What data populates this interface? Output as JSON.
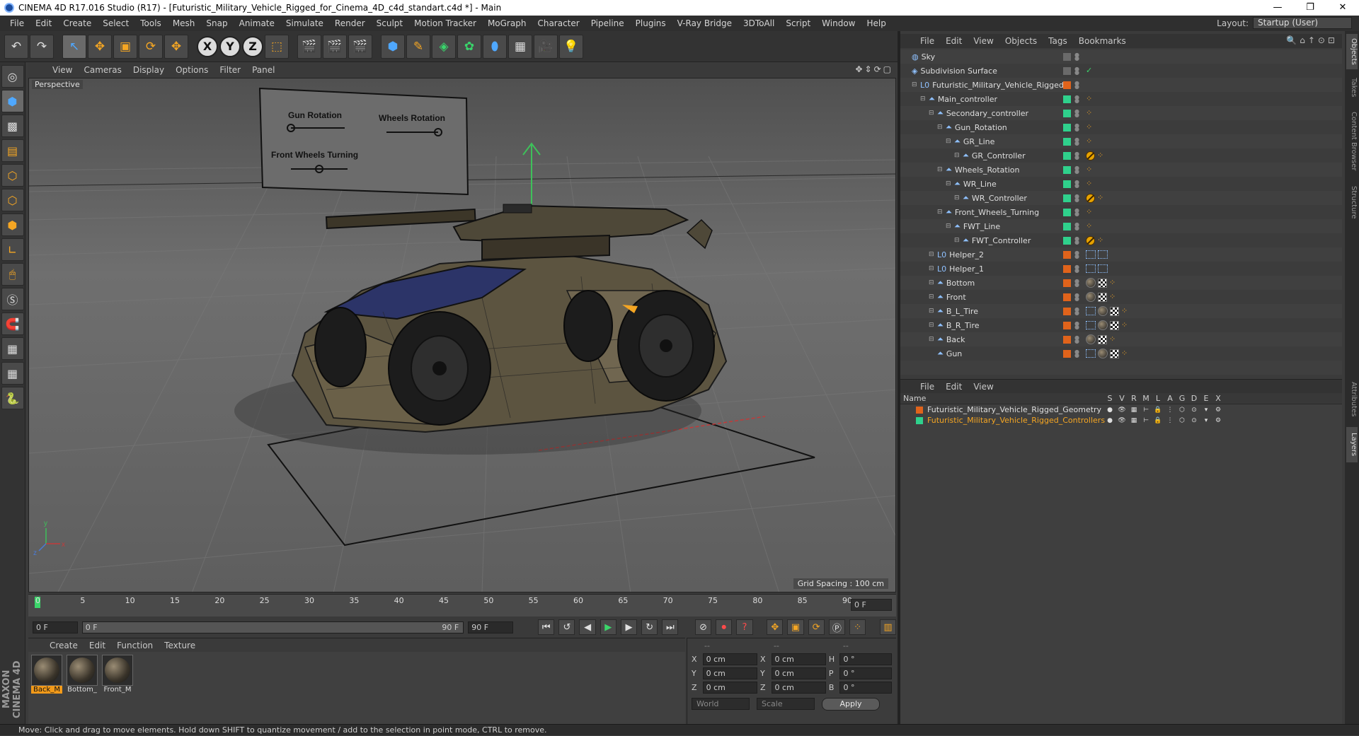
{
  "window": {
    "title": "CINEMA 4D R17.016 Studio (R17) - [Futuristic_Military_Vehicle_Rigged_for_Cinema_4D_c4d_standart.c4d *] - Main",
    "min": "—",
    "max": "❐",
    "close": "✕"
  },
  "menubar": {
    "items": [
      "File",
      "Edit",
      "Create",
      "Select",
      "Tools",
      "Mesh",
      "Snap",
      "Animate",
      "Simulate",
      "Render",
      "Sculpt",
      "Motion Tracker",
      "MoGraph",
      "Character",
      "Pipeline",
      "Plugins",
      "V-Ray Bridge",
      "3DToAll",
      "Script",
      "Window",
      "Help"
    ],
    "layout_label": "Layout:",
    "layout_value": "Startup (User)"
  },
  "toolbar": {
    "undo": "↶",
    "redo": "↷",
    "select": "↖",
    "move": "✥",
    "scale": "▣",
    "rotate": "⟳",
    "last": "✥",
    "x": "X",
    "y": "Y",
    "z": "Z",
    "coord": "⬚"
  },
  "viewport": {
    "menu": [
      "View",
      "Cameras",
      "Display",
      "Options",
      "Filter",
      "Panel"
    ],
    "label": "Perspective",
    "grid_spacing": "Grid Spacing : 100 cm",
    "hud": {
      "gun_rotation": "Gun Rotation",
      "wheels_rotation": "Wheels Rotation",
      "front_wheels_turning": "Front Wheels Turning",
      "gun_slider": 0.0,
      "wheels_slider": 1.0,
      "front_slider": 0.5
    },
    "axis_y": "y",
    "axis_x": "x",
    "axis_z": "z"
  },
  "timeline": {
    "ticks": [
      "0",
      "5",
      "10",
      "15",
      "20",
      "25",
      "30",
      "35",
      "40",
      "45",
      "50",
      "55",
      "60",
      "65",
      "70",
      "75",
      "80",
      "85",
      "90"
    ],
    "current": "0 F"
  },
  "transport": {
    "start": "0 F",
    "range_start": "0 F",
    "range_end": "90 F",
    "end": "90 F"
  },
  "materials": {
    "menu": [
      "Create",
      "Edit",
      "Function",
      "Texture"
    ],
    "items": [
      {
        "label": "Back_M",
        "selected": true
      },
      {
        "label": "Bottom_",
        "selected": false
      },
      {
        "label": "Front_M",
        "selected": false
      }
    ]
  },
  "coords": {
    "headers": [
      "--",
      "--",
      "--"
    ],
    "rows": [
      {
        "a": "X",
        "av": "0 cm",
        "b": "X",
        "bv": "0 cm",
        "c": "H",
        "cv": "0 °"
      },
      {
        "a": "Y",
        "av": "0 cm",
        "b": "Y",
        "bv": "0 cm",
        "c": "P",
        "cv": "0 °"
      },
      {
        "a": "Z",
        "av": "0 cm",
        "b": "Z",
        "bv": "0 cm",
        "c": "B",
        "cv": "0 °"
      }
    ],
    "world": "World",
    "scale": "Scale",
    "apply": "Apply"
  },
  "objects": {
    "menu": [
      "File",
      "Edit",
      "View",
      "Objects",
      "Tags",
      "Bookmarks"
    ],
    "rows": [
      {
        "name": "Sky",
        "indent": 0,
        "icon": "sky-icon",
        "glyph": "◍",
        "layer": "",
        "tags": []
      },
      {
        "name": "Subdivision Surface",
        "indent": 0,
        "icon": "subdivision-icon",
        "glyph": "◈",
        "layer": "",
        "tags": [
          "check"
        ]
      },
      {
        "name": "Futuristic_Military_Vehicle_Rigged",
        "indent": 1,
        "icon": "null-icon",
        "glyph": "L0",
        "layer": "#e0631b",
        "tags": []
      },
      {
        "name": "Main_controller",
        "indent": 2,
        "icon": "joint-icon",
        "glyph": "⏶",
        "layer": "#2fd18c",
        "tags": [
          "pose"
        ]
      },
      {
        "name": "Secondary_controller",
        "indent": 3,
        "icon": "joint-icon",
        "glyph": "⏶",
        "layer": "#2fd18c",
        "tags": [
          "pose"
        ]
      },
      {
        "name": "Gun_Rotation",
        "indent": 4,
        "icon": "joint-icon",
        "glyph": "⏶",
        "layer": "#2fd18c",
        "tags": [
          "pose"
        ]
      },
      {
        "name": "GR_Line",
        "indent": 5,
        "icon": "joint-icon",
        "glyph": "⏶",
        "layer": "#2fd18c",
        "tags": [
          "pose"
        ]
      },
      {
        "name": "GR_Controller",
        "indent": 6,
        "icon": "joint-icon",
        "glyph": "⏶",
        "layer": "#2fd18c",
        "tags": [
          "prot",
          "pose"
        ]
      },
      {
        "name": "Wheels_Rotation",
        "indent": 4,
        "icon": "joint-icon",
        "glyph": "⏶",
        "layer": "#2fd18c",
        "tags": [
          "pose"
        ]
      },
      {
        "name": "WR_Line",
        "indent": 5,
        "icon": "joint-icon",
        "glyph": "⏶",
        "layer": "#2fd18c",
        "tags": [
          "pose"
        ]
      },
      {
        "name": "WR_Controller",
        "indent": 6,
        "icon": "joint-icon",
        "glyph": "⏶",
        "layer": "#2fd18c",
        "tags": [
          "prot",
          "pose"
        ]
      },
      {
        "name": "Front_Wheels_Turning",
        "indent": 4,
        "icon": "joint-icon",
        "glyph": "⏶",
        "layer": "#2fd18c",
        "tags": [
          "pose"
        ]
      },
      {
        "name": "FWT_Line",
        "indent": 5,
        "icon": "joint-icon",
        "glyph": "⏶",
        "layer": "#2fd18c",
        "tags": [
          "pose"
        ]
      },
      {
        "name": "FWT_Controller",
        "indent": 6,
        "icon": "joint-icon",
        "glyph": "⏶",
        "layer": "#2fd18c",
        "tags": [
          "prot",
          "pose"
        ]
      },
      {
        "name": "Helper_2",
        "indent": 3,
        "icon": "null-icon",
        "glyph": "L0",
        "layer": "#e0631b",
        "tags": [
          "sel",
          "sel"
        ]
      },
      {
        "name": "Helper_1",
        "indent": 3,
        "icon": "null-icon",
        "glyph": "L0",
        "layer": "#e0631b",
        "tags": [
          "sel",
          "sel"
        ]
      },
      {
        "name": "Bottom",
        "indent": 3,
        "icon": "joint-icon",
        "glyph": "⏶",
        "layer": "#e0631b",
        "tags": [
          "mat",
          "chk",
          "pose"
        ]
      },
      {
        "name": "Front",
        "indent": 3,
        "icon": "joint-icon",
        "glyph": "⏶",
        "layer": "#e0631b",
        "tags": [
          "mat",
          "chk",
          "pose"
        ]
      },
      {
        "name": "B_L_Tire",
        "indent": 3,
        "icon": "joint-icon",
        "glyph": "⏶",
        "layer": "#e0631b",
        "tags": [
          "sel",
          "mat",
          "chk",
          "pose"
        ]
      },
      {
        "name": "B_R_Tire",
        "indent": 3,
        "icon": "joint-icon",
        "glyph": "⏶",
        "layer": "#e0631b",
        "tags": [
          "sel",
          "mat",
          "chk",
          "pose"
        ]
      },
      {
        "name": "Back",
        "indent": 3,
        "icon": "joint-icon",
        "glyph": "⏶",
        "layer": "#e0631b",
        "tags": [
          "mat",
          "chk",
          "pose"
        ]
      },
      {
        "name": "Gun",
        "indent": 3,
        "icon": "joint-icon",
        "glyph": "⏶",
        "layer": "#e0631b",
        "tags": [
          "sel",
          "mat",
          "chk",
          "pose"
        ]
      }
    ]
  },
  "layers": {
    "menu": [
      "File",
      "Edit",
      "View"
    ],
    "header_name": "Name",
    "cols": [
      "S",
      "V",
      "R",
      "M",
      "L",
      "A",
      "G",
      "D",
      "E",
      "X"
    ],
    "rows": [
      {
        "name": "Futuristic_Military_Vehicle_Rigged_Geometry",
        "color": "#e0631b",
        "text_color": "#dedede"
      },
      {
        "name": "Futuristic_Military_Vehicle_Rigged_Controllers",
        "color": "#2fd18c",
        "text_color": "#f5a623"
      }
    ]
  },
  "side_tabs": [
    "Objects",
    "Takes",
    "Content Browser",
    "Structure",
    "Attributes",
    "Layers"
  ],
  "maxon": "MAXON CINEMA 4D",
  "status": "Move: Click and drag to move elements. Hold down SHIFT to quantize movement / add to the selection in point mode, CTRL to remove."
}
